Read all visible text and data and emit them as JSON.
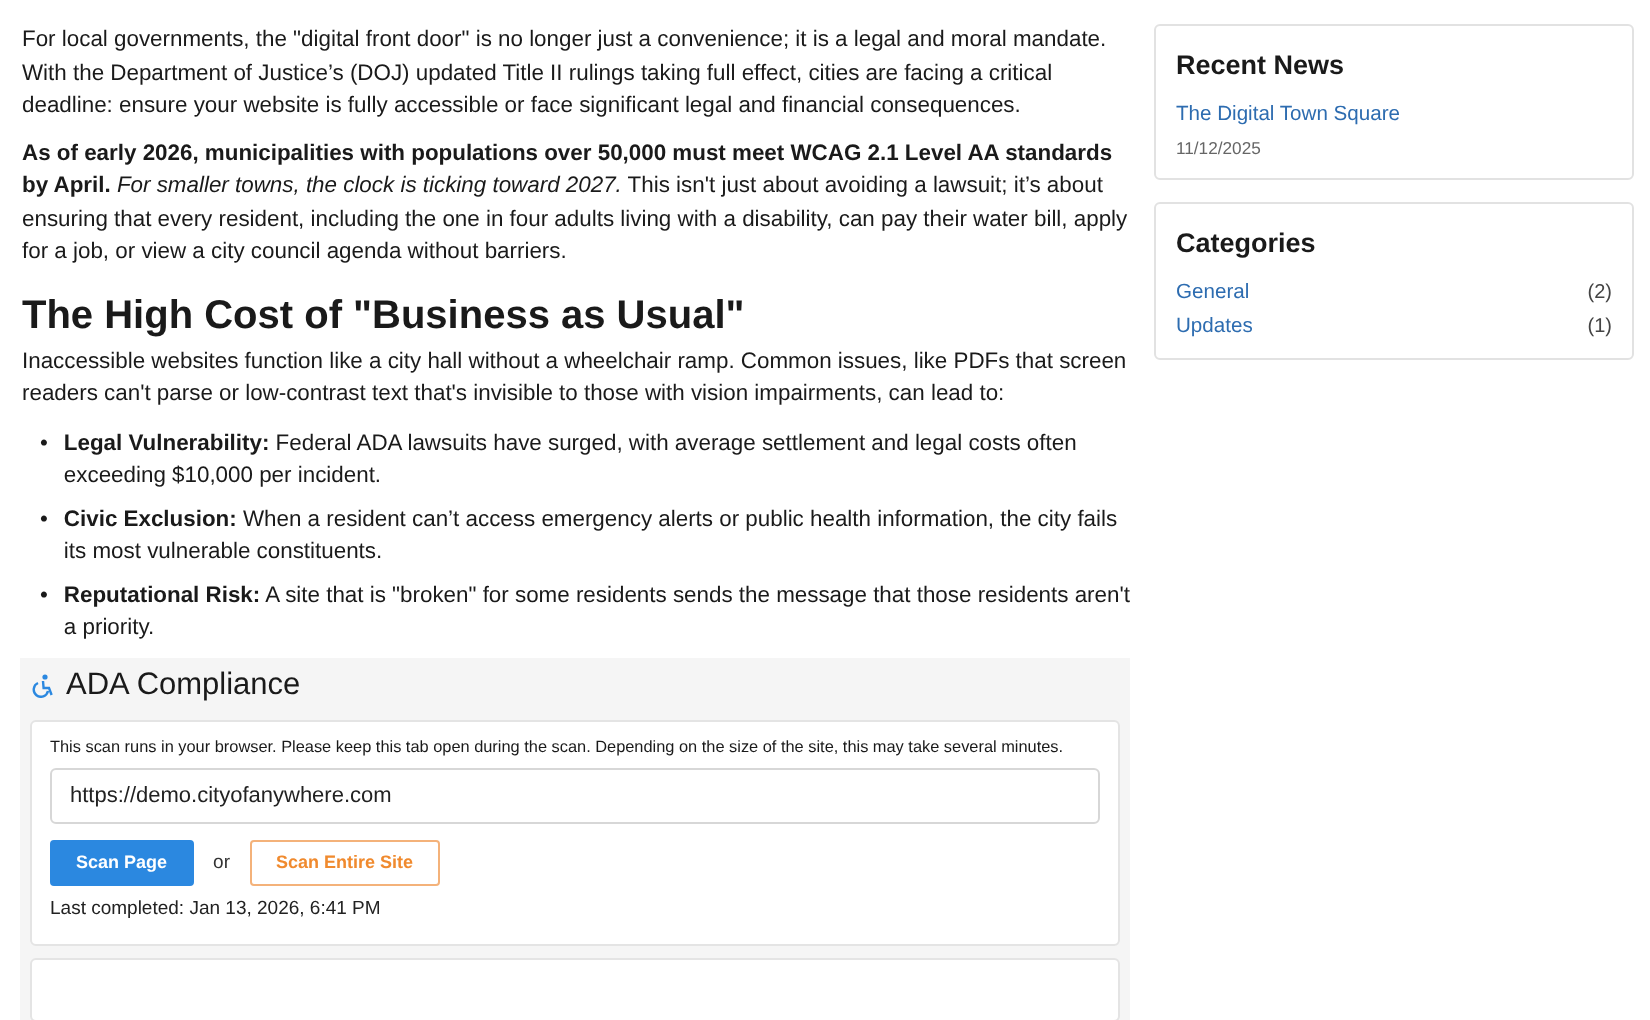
{
  "article": {
    "paragraphs": [
      "For local governments, the \"digital front door\" is no longer just a convenience; it is a legal and moral mandate. With the Department of Justice’s (DOJ) updated Title II rulings taking full effect, cities are facing a critical deadline: ensure your website is fully accessible or face significant legal and financial consequences.",
      "**As of early 2026, municipalities with populations over 50,000 must meet WCAG 2.1 Level AA standards by April.** *For smaller towns, the clock is ticking toward 2027.* This isn't just about avoiding a lawsuit; it’s about ensuring that every resident, including the one in four adults living with a disability, can pay their water bill, apply for a job, or view a city council agenda without barriers."
    ],
    "heading": "The High Cost of \"Business as Usual\"",
    "intro": "Inaccessible websites function like a city hall without a wheelchair ramp. Common issues, like PDFs that screen readers can't parse or low-contrast text that's invisible to those with vision impairments, can lead to:",
    "bullets": [
      {
        "marker": "•",
        "text": "**Legal Vulnerability:** Federal ADA lawsuits have surged, with average settlement and legal costs often exceeding $10,000 per incident."
      },
      {
        "marker": "•",
        "text": "**Civic Exclusion:** When a resident can’t access emergency alerts or public health information, the city fails its most vulnerable constituents."
      },
      {
        "marker": "•",
        "text": "**Reputational Risk:** A site that is \"broken\" for some residents sends the message that those residents aren't a priority."
      }
    ]
  },
  "ada_panel": {
    "title": "ADA Compliance",
    "notice": "This scan runs in your browser. Please keep this tab open during the scan. Depending on the size of the site, this may take several minutes.",
    "url": {
      "value": "https://demo.cityofanywhere.com"
    },
    "primary_button": "Scan Page",
    "separator": "or",
    "secondary_button": "Scan Entire Site",
    "last_completed": "Last completed: Jan 13, 2026, 6:41 PM"
  },
  "sidebar": {
    "recent_news": {
      "title": "Recent News",
      "items": [
        {
          "title": "The Digital Town Square",
          "date": "11/12/2025"
        }
      ]
    },
    "categories": {
      "title": "Categories",
      "items": [
        {
          "name": "General",
          "count": "(2)"
        },
        {
          "name": "Updates",
          "count": "(1)"
        }
      ]
    }
  }
}
